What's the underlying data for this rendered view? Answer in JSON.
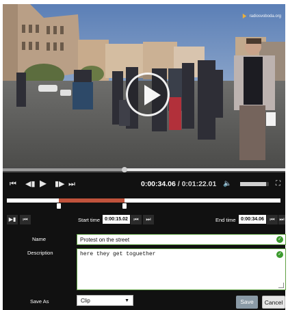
{
  "video": {
    "watermark": "radiosvoboda.org",
    "playback_progress": 0.43,
    "volume_level": 0.9
  },
  "controls": {
    "current_time": "0:00:34.06",
    "separator": " / ",
    "duration": "0:01:22.01"
  },
  "clip_range": {
    "start_fraction": 0.19,
    "end_fraction": 0.43
  },
  "editor": {
    "start_time_label": "Start time",
    "start_time_value": "0:00:15.02",
    "end_time_label": "End time",
    "end_time_value": "0:00:34.06",
    "name_label": "Name",
    "name_value": "Protest on the street",
    "description_label": "Description",
    "description_value": "here they get toguether",
    "save_as_label": "Save As",
    "save_as_selected": "Clip",
    "save_button": "Save",
    "cancel_button": "Cancel"
  },
  "colors": {
    "range_selection": "#c0533c",
    "valid_check": "#3c9a2e",
    "save_button": "#8a9aa6"
  }
}
